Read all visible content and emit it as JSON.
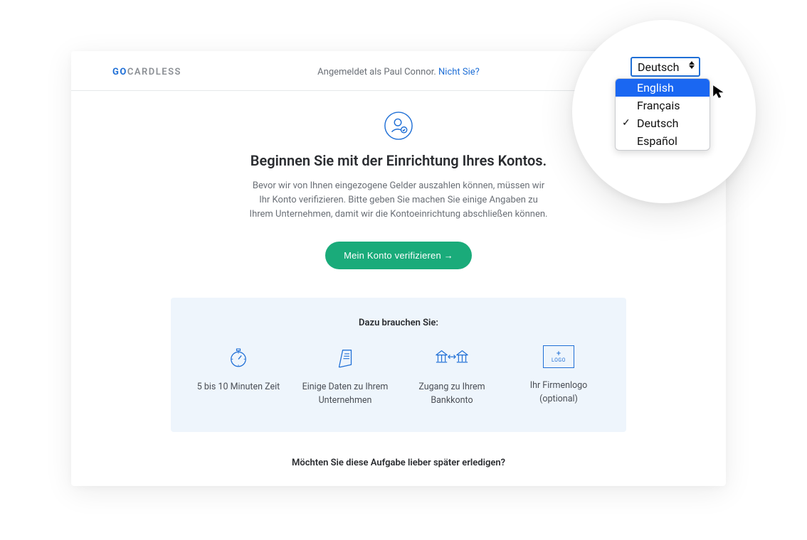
{
  "brand": {
    "go": "GO",
    "rest": "CARDLESS"
  },
  "header": {
    "signed_in_prefix": "Angemeldet als ",
    "user_name": "Paul Connor",
    "not_you": "Nicht Sie?"
  },
  "hero": {
    "title": "Beginnen Sie mit der Einrichtung Ihres Kontos.",
    "body": "Bevor wir von Ihnen eingezogene Gelder auszahlen können, müssen wir Ihr Konto verifizieren. Bitte geben Sie machen Sie einige Angaben zu Ihrem Unternehmen, damit wir die Kontoeinrichtung abschließen können.",
    "cta": "Mein Konto verifizieren →"
  },
  "need": {
    "heading": "Dazu brauchen Sie:",
    "items": [
      {
        "label": "5 bis 10 Minuten Zeit"
      },
      {
        "label": "Einige Daten zu Ihrem Unternehmen"
      },
      {
        "label": "Zugang zu Ihrem Bankkonto"
      },
      {
        "label": "Ihr Firmenlogo (optional)"
      }
    ],
    "logo_placeholder_plus": "+",
    "logo_placeholder_word": "LOGO"
  },
  "later": "Möchten Sie diese Aufgabe lieber später erledigen?",
  "language": {
    "current": "Deutsch",
    "options": [
      {
        "label": "English",
        "highlighted": true,
        "checked": false
      },
      {
        "label": "Français",
        "highlighted": false,
        "checked": false
      },
      {
        "label": "Deutsch",
        "highlighted": false,
        "checked": true
      },
      {
        "label": "Español",
        "highlighted": false,
        "checked": false
      }
    ],
    "checkmark": "✓"
  },
  "colors": {
    "primary_blue": "#1f6fd6",
    "cta_green": "#1aab7a",
    "panel_blue": "#eef5fc",
    "menu_highlight": "#1a67f2"
  }
}
